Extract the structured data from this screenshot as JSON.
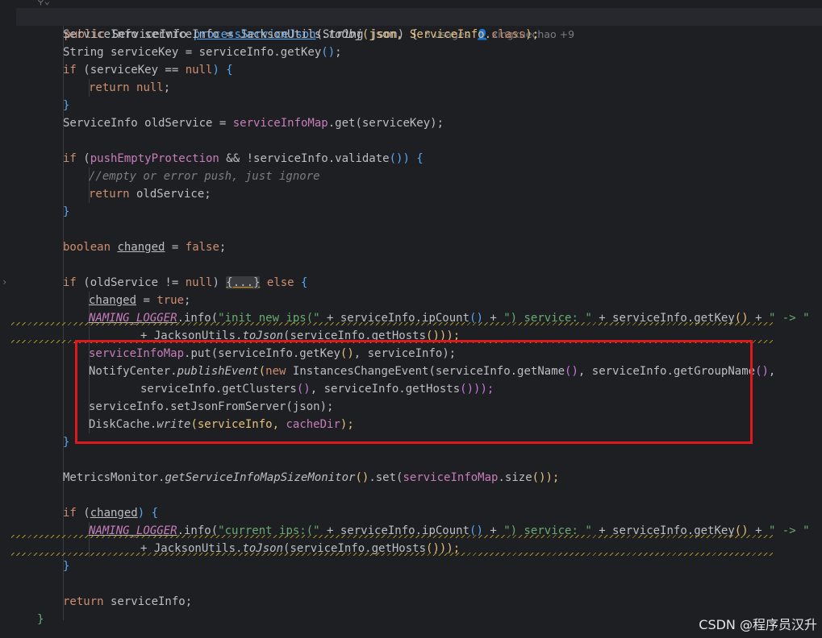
{
  "method": {
    "public_kw": "public",
    "return_type": "ServiceInfo",
    "name": "processServiceJson",
    "params": "(String json) {",
    "usages": "8 usages",
    "author": "xingxuechao +9"
  },
  "lines": {
    "l2": {
      "a": "ServiceInfo serviceInfo = JacksonUtils.",
      "b": "toObj",
      "c": "(json, ServiceInfo.",
      "d": "class",
      "e": ");"
    },
    "l3": {
      "a": "String serviceKey = serviceInfo.getKey",
      "b": "()",
      "c": ";"
    },
    "l4": {
      "kw": "if",
      "a": " (serviceKey == ",
      "nul": "null",
      "b": ") {"
    },
    "l5": {
      "kw": "return",
      "nul": "null",
      "c": ";"
    },
    "l6": "}",
    "l7": {
      "a": "ServiceInfo oldService = ",
      "fld": "serviceInfoMap",
      "b": ".get(serviceKey);"
    },
    "l9": {
      "kw": "if",
      "a": " (",
      "fld": "pushEmptyProtection",
      "b": " && !serviceInfo.validate",
      "c": "()) {"
    },
    "l10": "//empty or error push, just ignore",
    "l11": {
      "kw": "return",
      "a": " oldService;"
    },
    "l12": "}",
    "l14": {
      "kw": "boolean",
      "var": "changed",
      "a": " = ",
      "val": "false",
      "b": ";"
    },
    "l16": {
      "kw": "if",
      "a": " (oldService != ",
      "nul": "null",
      "b": ") ",
      "fold": "{...}",
      "kw2": "else",
      "c": " {"
    },
    "l17": {
      "var": "changed",
      "a": " = ",
      "val": "true",
      "b": ";"
    },
    "l18": {
      "st": "NAMING_LOGGER",
      "a": ".info(",
      "s1": "\"init new ips(\"",
      "b": " + serviceInfo.ipCount",
      "c": "()",
      "d": " + ",
      "s2": "\") service: \"",
      "e": " + serviceInfo.getKey",
      "f": "()",
      "g": " + ",
      "s3": "\" -> \""
    },
    "l19": {
      "a": "+ JacksonUtils.",
      "b": "toJson",
      "c": "(serviceInfo.getHosts",
      "d": "()));"
    },
    "l20": {
      "fld": "serviceInfoMap",
      "a": ".put(serviceInfo.getKey",
      "b": "()",
      "c": ", serviceInfo);"
    },
    "l21": {
      "a": "NotifyCenter.",
      "b": "publishEvent",
      "c": "(",
      "kw": "new",
      "d": " InstancesChangeEvent(serviceInfo.getName",
      "e": "()",
      "f": ", serviceInfo.getGroupName",
      "g": "()",
      "h": ","
    },
    "l22": {
      "a": "serviceInfo.getClusters",
      "b": "()",
      "c": ", serviceInfo.getHosts",
      "d": "()));"
    },
    "l23": {
      "a": "serviceInfo.setJsonFromServer(json);"
    },
    "l24": {
      "a": "DiskCache.",
      "b": "write",
      "c": "(serviceInfo, ",
      "fld": "cacheDir",
      "d": ");"
    },
    "l25": "}",
    "l27": {
      "a": "MetricsMonitor.",
      "b": "getServiceInfoMapSizeMonitor",
      "c": "()",
      "d": ".set(",
      "fld": "serviceInfoMap",
      "e": ".size",
      "f": "());"
    },
    "l29": {
      "kw": "if",
      "a": " (",
      "var": "changed",
      "b": ") {"
    },
    "l30": {
      "st": "NAMING_LOGGER",
      "a": ".info(",
      "s1": "\"current ips:(\"",
      "b": " + serviceInfo.ipCount",
      "c": "()",
      "d": " + ",
      "s2": "\") service: \"",
      "e": " + serviceInfo.getKey",
      "f": "()",
      "g": " + ",
      "s3": "\" -> \""
    },
    "l31": {
      "a": "+ JacksonUtils.",
      "b": "toJson",
      "c": "(serviceInfo.getHosts",
      "d": "()));"
    },
    "l32": "}",
    "l34": {
      "kw": "return",
      "a": " serviceInfo;"
    },
    "l35": "}"
  },
  "watermark": "CSDN @程序员汉升",
  "colors": {
    "background": "#1e1f22",
    "keyword": "#cf8e6d",
    "method": "#56a8f5",
    "field": "#c77dbb",
    "string": "#6aab73",
    "comment": "#7a7e85",
    "highlight_box": "#e0171c"
  }
}
